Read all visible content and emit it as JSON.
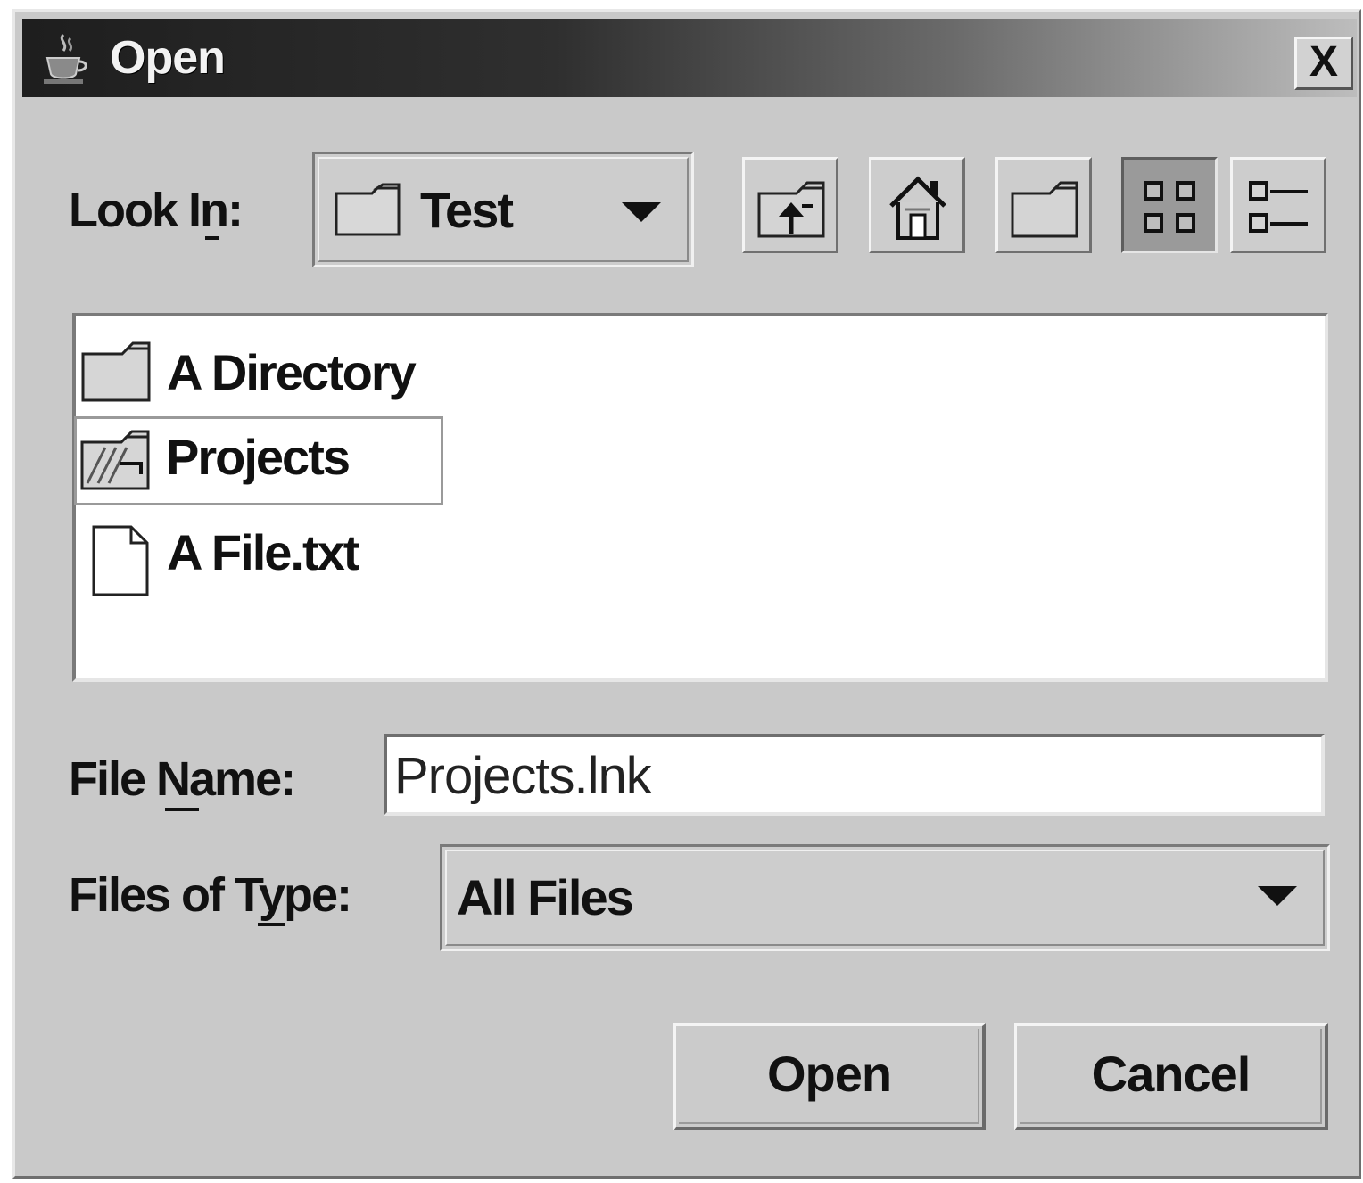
{
  "window": {
    "title": "Open",
    "close_label": "X",
    "icon": "java-cup-icon"
  },
  "look_in": {
    "label": "Look In:",
    "selected": "Test",
    "icon": "folder-icon"
  },
  "toolbar": {
    "buttons": [
      {
        "name": "up-one-level-button",
        "icon": "folder-up-icon"
      },
      {
        "name": "home-button",
        "icon": "home-icon"
      },
      {
        "name": "new-folder-button",
        "icon": "new-folder-icon"
      },
      {
        "name": "list-view-button",
        "icon": "list-view-icon",
        "pressed": true
      },
      {
        "name": "details-view-button",
        "icon": "details-view-icon",
        "pressed": false
      }
    ]
  },
  "files": [
    {
      "name": "A Directory",
      "type": "folder",
      "icon": "folder-icon",
      "selected": false
    },
    {
      "name": "Projects",
      "type": "shortcut",
      "icon": "folder-shortcut-icon",
      "selected": true
    },
    {
      "name": "A File.txt",
      "type": "file",
      "icon": "file-icon",
      "selected": false
    }
  ],
  "file_name": {
    "label": "File Name:",
    "value": "Projects.lnk"
  },
  "files_of_type": {
    "label": "Files of Type:",
    "selected": "All Files"
  },
  "actions": {
    "open_label": "Open",
    "cancel_label": "Cancel"
  }
}
